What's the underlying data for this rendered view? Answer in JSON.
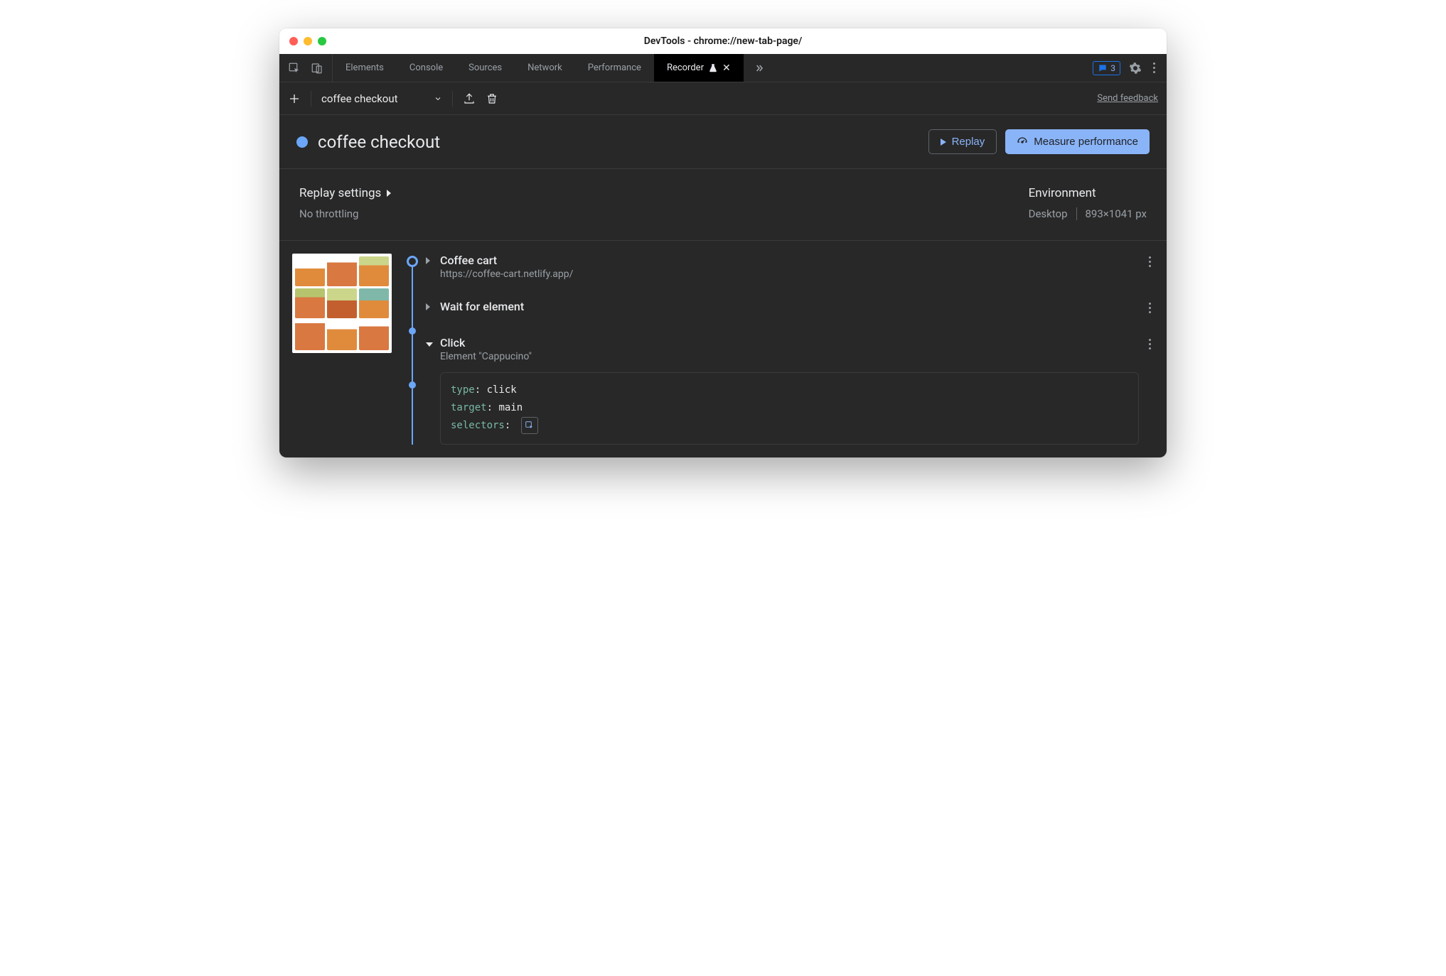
{
  "window": {
    "title": "DevTools - chrome://new-tab-page/"
  },
  "tabbar": {
    "tabs": [
      "Elements",
      "Console",
      "Sources",
      "Network",
      "Performance",
      "Recorder"
    ],
    "issues_count": "3"
  },
  "toolbar": {
    "recording_name": "coffee checkout",
    "feedback": "Send feedback"
  },
  "header": {
    "title": "coffee checkout",
    "replay": "Replay",
    "measure": "Measure performance"
  },
  "settings": {
    "replay_label": "Replay settings",
    "throttle": "No throttling",
    "env_label": "Environment",
    "device": "Desktop",
    "viewport": "893×1041 px"
  },
  "steps": {
    "s0": {
      "title": "Coffee cart",
      "url": "https://coffee-cart.netlify.app/"
    },
    "s1": {
      "title": "Wait for element"
    },
    "s2": {
      "title": "Click",
      "sub": "Element \"Cappucino\""
    }
  },
  "code": {
    "k_type": "type",
    "v_type": "click",
    "k_target": "target",
    "v_target": "main",
    "k_selectors": "selectors"
  }
}
